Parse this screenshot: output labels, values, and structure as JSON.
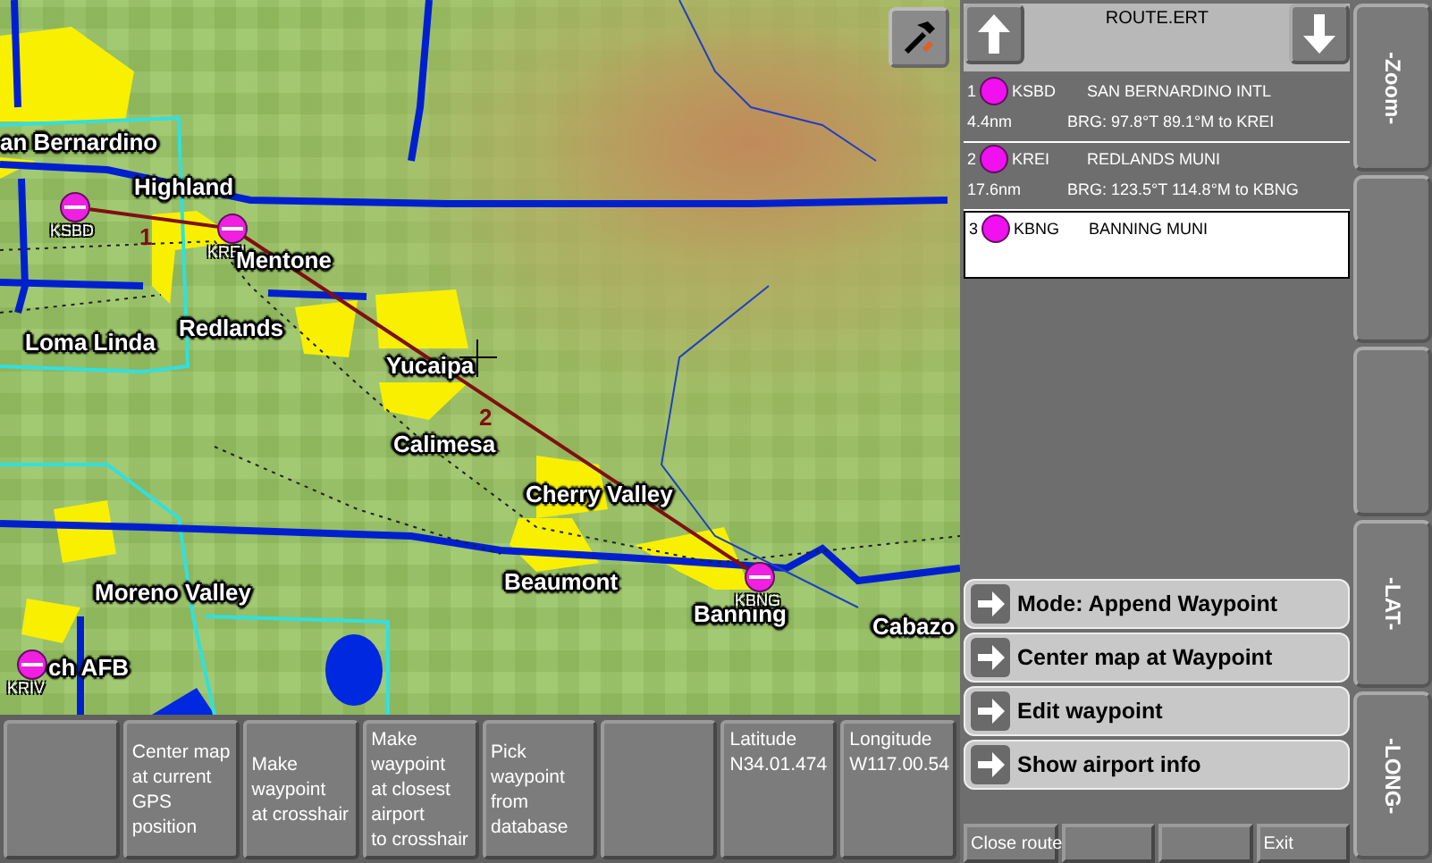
{
  "map": {
    "towns": [
      "an Bernardino",
      "Highland",
      "Mentone",
      "Redlands",
      "Loma Linda",
      "Yucaipa",
      "Calimesa",
      "Cherry Valley",
      "Beaumont",
      "Banning",
      "Cabazo",
      "Moreno Valley",
      "ch AFB"
    ],
    "waypoints": [
      "KSBD",
      "KREI",
      "KBNG",
      "KRIV"
    ],
    "legs": [
      "1",
      "2"
    ]
  },
  "route": {
    "title": "ROUTE.ERT",
    "waypoints": [
      {
        "num": "1",
        "id": "KSBD",
        "name": "SAN BERNARDINO INTL",
        "distance": "4.4nm",
        "bearing": "BRG: 97.8°T 89.1°M  to KREI",
        "selected": false
      },
      {
        "num": "2",
        "id": "KREI",
        "name": "REDLANDS MUNI",
        "distance": "17.6nm",
        "bearing": "BRG: 123.5°T 114.8°M  to KBNG",
        "selected": false
      },
      {
        "num": "3",
        "id": "KBNG",
        "name": "BANNING MUNI",
        "selected": true
      }
    ]
  },
  "actions": [
    "Mode: Append Waypoint",
    "Center map at Waypoint",
    "Edit waypoint",
    "Show airport info"
  ],
  "route_buttons": [
    {
      "kind": "button",
      "label": "Close route"
    },
    {
      "kind": "blank"
    },
    {
      "kind": "blank"
    },
    {
      "kind": "button",
      "label": "Exit"
    }
  ],
  "side_buttons": [
    {
      "kind": "button",
      "label": "-Zoom-"
    },
    {
      "kind": "blank"
    },
    {
      "kind": "blank"
    },
    {
      "kind": "button",
      "label": "-LAT-"
    },
    {
      "kind": "button",
      "label": "-LONG-"
    }
  ],
  "bottom_buttons": [
    {
      "kind": "blank"
    },
    {
      "kind": "button",
      "label": "Center map\nat current\nGPS\nposition"
    },
    {
      "kind": "button",
      "label": "Make\nwaypoint\nat crosshair"
    },
    {
      "kind": "button",
      "label": "Make\nwaypoint\nat closest\nairport\nto crosshair"
    },
    {
      "kind": "button",
      "label": "Pick\nwaypoint\nfrom\ndatabase"
    },
    {
      "kind": "blank"
    },
    {
      "kind": "readout",
      "label": "Latitude",
      "value": "N34.01.474"
    },
    {
      "kind": "readout",
      "label": "Longitude",
      "value": "W117.00.54"
    }
  ]
}
